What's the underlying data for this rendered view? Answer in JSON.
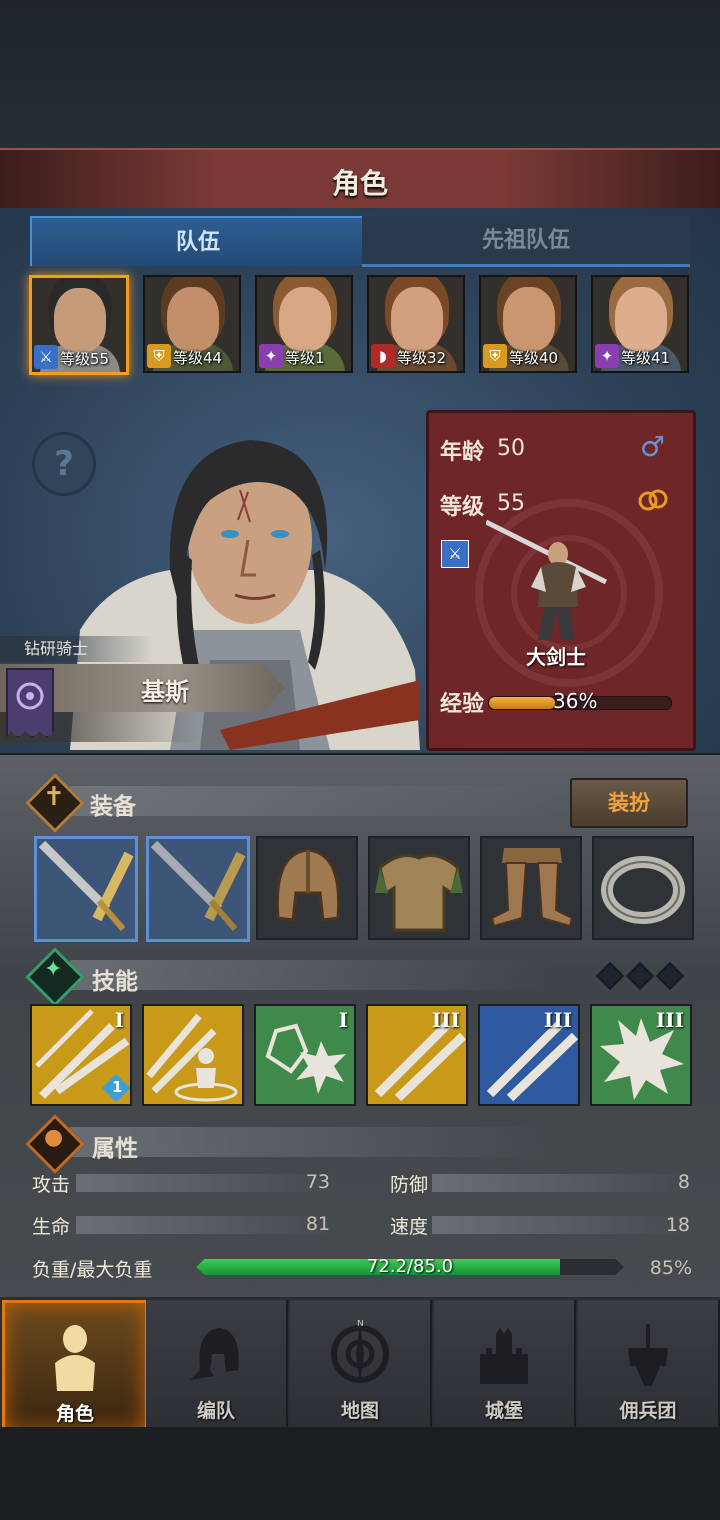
{
  "header": {
    "title": "角色"
  },
  "tabs": [
    {
      "label": "队伍"
    },
    {
      "label": "先祖队伍"
    }
  ],
  "party": [
    {
      "level_label": "等级55",
      "class_icon": "sword-icon",
      "badge_color": "#3a6fc8",
      "selected": true
    },
    {
      "level_label": "等级44",
      "class_icon": "shield-icon",
      "badge_color": "#d89a20"
    },
    {
      "level_label": "等级1",
      "class_icon": "staff-icon",
      "badge_color": "#8a3fb0"
    },
    {
      "level_label": "等级32",
      "class_icon": "bear-icon",
      "badge_color": "#b02a2a"
    },
    {
      "level_label": "等级40",
      "class_icon": "shield-icon",
      "badge_color": "#d89a20"
    },
    {
      "level_label": "等级41",
      "class_icon": "staff-icon",
      "badge_color": "#8a3fb0"
    }
  ],
  "hero": {
    "title": "钻研骑士",
    "name": "基斯",
    "age_label": "年龄",
    "age": "50",
    "level_label": "等级",
    "level": "55",
    "class_name": "大剑士",
    "exp_label": "经验",
    "exp_percent_text": "36%",
    "exp_fraction": 0.36
  },
  "equipment": {
    "title": "装备",
    "dress_button": "装扮",
    "slots": [
      "greatsword-icon",
      "greatsword-icon",
      "helmet-icon",
      "armor-icon",
      "greaves-icon",
      "ring-icon"
    ]
  },
  "skills": {
    "title": "技能",
    "items": [
      {
        "icon": "sword-slash-icon",
        "tier": "I",
        "bg": "#c99a1a"
      },
      {
        "icon": "sword-aura-icon",
        "tier": "",
        "bg": "#c99a1a"
      },
      {
        "icon": "crystal-burst-icon",
        "tier": "I",
        "bg": "#3f8a4a"
      },
      {
        "icon": "cross-swords-icon",
        "tier": "III",
        "bg": "#c99a1a"
      },
      {
        "icon": "cross-swords-icon",
        "tier": "III",
        "bg": "#2f5aa0"
      },
      {
        "icon": "burst-icon",
        "tier": "III",
        "bg": "#3f8a4a"
      }
    ],
    "skill1_badge": "1"
  },
  "attributes": {
    "title": "属性",
    "attack_label": "攻击",
    "attack": "73",
    "defense_label": "防御",
    "defense": "8",
    "hp_label": "生命",
    "hp": "81",
    "speed_label": "速度",
    "speed": "18",
    "load_label": "负重/最大负重",
    "load_text": "72.2/85.0",
    "load_percent_text": "85%",
    "load_fraction": 0.85
  },
  "nav": [
    {
      "label": "角色",
      "icon": "knight-icon"
    },
    {
      "label": "编队",
      "icon": "helmet-formation-icon"
    },
    {
      "label": "地图",
      "icon": "compass-icon"
    },
    {
      "label": "城堡",
      "icon": "castle-icon"
    },
    {
      "label": "佣兵团",
      "icon": "banner-fist-icon"
    }
  ],
  "colors": {
    "accent": "#f0a020",
    "title_banner": "#7a3a35",
    "stat_card": "#6e2629"
  }
}
